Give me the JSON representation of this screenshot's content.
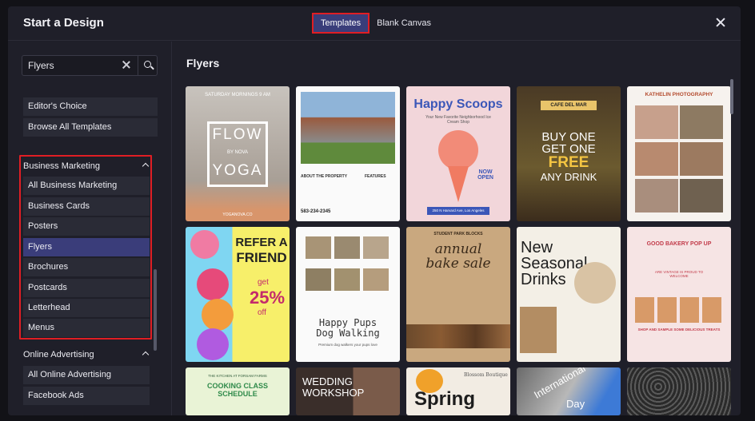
{
  "header": {
    "title": "Start a Design",
    "tabs": [
      "Templates",
      "Blank Canvas"
    ]
  },
  "search": {
    "value": "Flyers",
    "placeholder": "Search"
  },
  "sidebar": {
    "top_items": [
      "Editor's Choice",
      "Browse All Templates"
    ],
    "business_marketing": {
      "label": "Business Marketing",
      "items": [
        "All Business Marketing",
        "Business Cards",
        "Posters",
        "Flyers",
        "Brochures",
        "Postcards",
        "Letterhead",
        "Menus"
      ]
    },
    "online_advertising": {
      "label": "Online Advertising",
      "items": [
        "All Online Advertising",
        "Facebook Ads"
      ]
    }
  },
  "main": {
    "section_title": "Flyers",
    "cards": [
      {
        "name": "flow-yoga",
        "top": "SATURDAY MORNINGS 9 AM",
        "big1": "FLOW",
        "by": "BY NOVA",
        "big2": "YOGA",
        "footer": "YOGANOVA.CO"
      },
      {
        "name": "property",
        "h1": "ABOUT THE PROPERTY",
        "h2": "FEATURES",
        "phone": "583-234-2345"
      },
      {
        "name": "happy-scoops",
        "title": "Happy Scoops",
        "sub": "Your New Favorite Neighborhood Ice Cream Shop",
        "badge": "NOW OPEN",
        "addr": "250 N Harvard Ave, Los Angeles"
      },
      {
        "name": "cafe-del-mar",
        "tag": "CAFE DEL MAR",
        "l1": "BUY ONE",
        "l2": "GET ONE",
        "l3": "FREE",
        "l4": "ANY DRINK"
      },
      {
        "name": "kathelin-photography",
        "title": "KATHELIN PHOTOGRAPHY"
      },
      {
        "name": "refer-a-friend",
        "l1": "REFER A",
        "l2": "FRIEND",
        "get": "get",
        "pct": "25%",
        "off": "off"
      },
      {
        "name": "happy-pups",
        "l1": "Happy Pups",
        "l2": "Dog Walking",
        "sub": "Premium dog walkers your pups love"
      },
      {
        "name": "bake-sale",
        "top": "STUDENT PARK BLOCKS",
        "l1": "annual",
        "l2": "bake sale"
      },
      {
        "name": "new-seasonal-drinks",
        "l1": "New",
        "l2": "Seasonal",
        "l3": "Drinks"
      },
      {
        "name": "good-bakery",
        "l1": "GOOD BAKERY POP UP",
        "l2": "ARE VINTAGE IS PROUD TO WELCOME",
        "l3": "SHOP AND SAMPLE SOME DELICIOUS TREATS"
      },
      {
        "name": "cooking-class",
        "top": "THE KITCHEN AT FORSAM FARMS",
        "l1": "COOKING CLASS",
        "l2": "SCHEDULE"
      },
      {
        "name": "wedding-workshop",
        "l1": "WEDDING",
        "l2": "WORKSHOP"
      },
      {
        "name": "spring",
        "top": "Blossom Boutique",
        "l1": "Spring"
      },
      {
        "name": "international-day",
        "l1": "International",
        "l2": "Day"
      },
      {
        "name": "crowd-photo"
      }
    ]
  },
  "colors": {
    "accent": "#3a3d7a",
    "highlight": "#e01e24",
    "panel": "#1f1f29"
  }
}
